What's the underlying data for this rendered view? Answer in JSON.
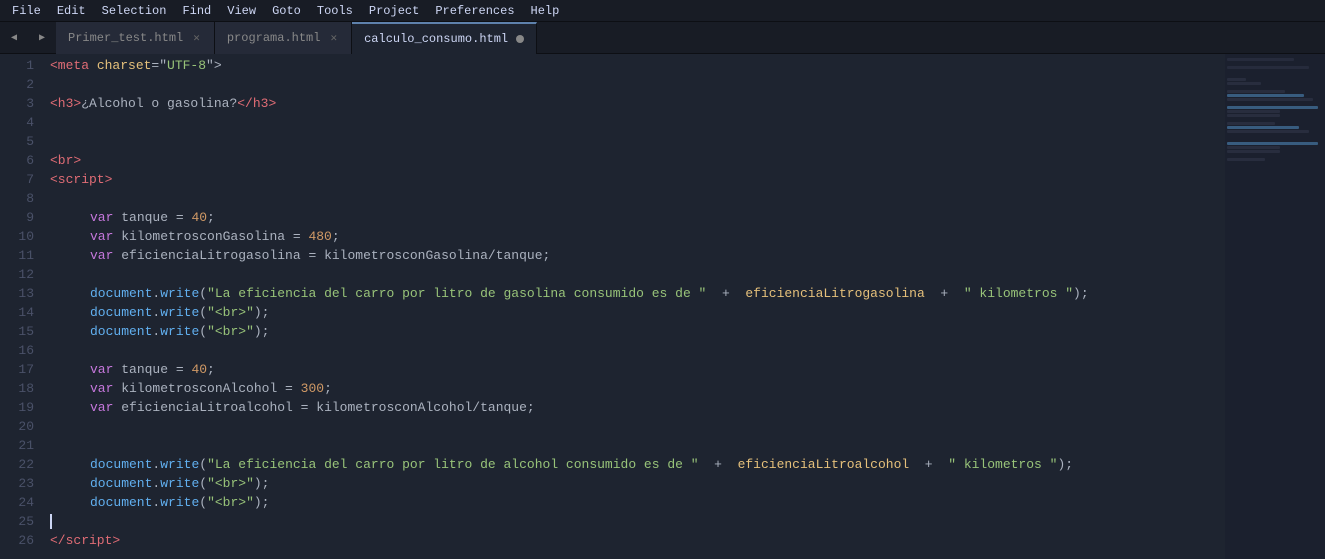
{
  "menu": {
    "items": [
      "File",
      "Edit",
      "Selection",
      "Find",
      "View",
      "Goto",
      "Tools",
      "Project",
      "Preferences",
      "Help"
    ]
  },
  "tabs": [
    {
      "id": "tab1",
      "label": "Primer_test.html",
      "active": false,
      "dot": false,
      "close": true
    },
    {
      "id": "tab2",
      "label": "programa.html",
      "active": false,
      "dot": false,
      "close": true
    },
    {
      "id": "tab3",
      "label": "calculo_consumo.html",
      "active": true,
      "dot": true,
      "close": false
    }
  ],
  "lines": [
    {
      "num": 1,
      "content": "meta_tag"
    },
    {
      "num": 2,
      "content": "empty"
    },
    {
      "num": 3,
      "content": "h3_tag"
    },
    {
      "num": 4,
      "content": "empty"
    },
    {
      "num": 5,
      "content": "empty"
    },
    {
      "num": 6,
      "content": "br_tag"
    },
    {
      "num": 7,
      "content": "script_open"
    },
    {
      "num": 8,
      "content": "empty"
    },
    {
      "num": 9,
      "content": "var_tanque"
    },
    {
      "num": 10,
      "content": "var_km_gas"
    },
    {
      "num": 11,
      "content": "var_efic_gas"
    },
    {
      "num": 12,
      "content": "empty"
    },
    {
      "num": 13,
      "content": "doc_write_gas"
    },
    {
      "num": 14,
      "content": "doc_write_br1"
    },
    {
      "num": 15,
      "content": "doc_write_br2"
    },
    {
      "num": 16,
      "content": "empty"
    },
    {
      "num": 17,
      "content": "var_tanque2"
    },
    {
      "num": 18,
      "content": "var_km_alc"
    },
    {
      "num": 19,
      "content": "var_efic_alc"
    },
    {
      "num": 20,
      "content": "empty"
    },
    {
      "num": 21,
      "content": "empty"
    },
    {
      "num": 22,
      "content": "doc_write_alc"
    },
    {
      "num": 23,
      "content": "doc_write_br3"
    },
    {
      "num": 24,
      "content": "doc_write_br4"
    },
    {
      "num": 25,
      "content": "cursor_line"
    },
    {
      "num": 26,
      "content": "script_close"
    }
  ]
}
